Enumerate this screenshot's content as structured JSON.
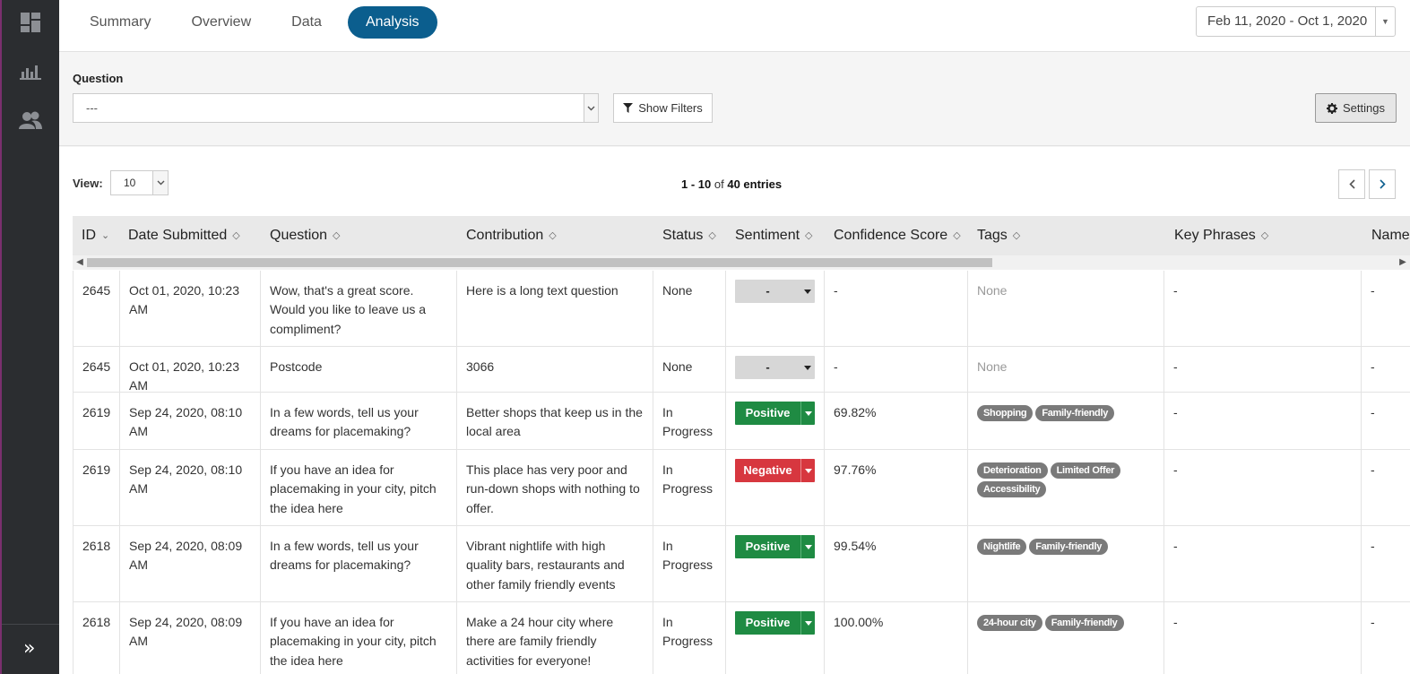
{
  "sidebar": {
    "icons": [
      "dashboard-icon",
      "bar-chart-icon",
      "users-icon"
    ],
    "expand_icon": "»"
  },
  "tabs": [
    {
      "label": "Summary",
      "active": false
    },
    {
      "label": "Overview",
      "active": false
    },
    {
      "label": "Data",
      "active": false
    },
    {
      "label": "Analysis",
      "active": true
    }
  ],
  "date_range": {
    "value": "Feb 11, 2020 - Oct 1, 2020"
  },
  "filter": {
    "question_label": "Question",
    "question_value": "---",
    "show_filters_label": "Show Filters",
    "settings_label": "Settings"
  },
  "view": {
    "label": "View:",
    "value": "10"
  },
  "entries": {
    "range": "1 - 10",
    "of": "of",
    "total": "40 entries"
  },
  "columns": [
    "ID",
    "Date Submitted",
    "Question",
    "Contribution",
    "Status",
    "Sentiment",
    "Confidence Score",
    "Tags",
    "Key Phrases",
    "Name"
  ],
  "rows": [
    {
      "id": "2645",
      "date": "Oct 01, 2020, 10:23 AM",
      "question": "Wow, that's a great score. Would you like to leave us a compliment?",
      "contribution": "Here is a long text question",
      "status": "None",
      "sentiment": "-",
      "sentiment_type": "none",
      "confidence": "-",
      "tags": [],
      "tags_empty": "None",
      "key_phrases": "-",
      "name": "-"
    },
    {
      "id": "2645",
      "date": "Oct 01, 2020, 10:23 AM",
      "question": "Postcode",
      "contribution": "3066",
      "status": "None",
      "sentiment": "-",
      "sentiment_type": "none",
      "confidence": "-",
      "tags": [],
      "tags_empty": "None",
      "key_phrases": "-",
      "name": "-"
    },
    {
      "id": "2619",
      "date": "Sep 24, 2020, 08:10 AM",
      "question": "In a few words, tell us your dreams for placemaking?",
      "contribution": "Better shops that keep us in the local area",
      "status": "In Progress",
      "sentiment": "Positive",
      "sentiment_type": "pos",
      "confidence": "69.82%",
      "tags": [
        "Shopping",
        "Family-friendly"
      ],
      "key_phrases": "-",
      "name": "-"
    },
    {
      "id": "2619",
      "date": "Sep 24, 2020, 08:10 AM",
      "question": "If you have an idea for placemaking in your city, pitch the idea here",
      "contribution": "This place has very poor and run-down shops with nothing to offer.",
      "status": "In Progress",
      "sentiment": "Negative",
      "sentiment_type": "neg",
      "confidence": "97.76%",
      "tags": [
        "Deterioration",
        "Limited Offer",
        "Accessibility"
      ],
      "key_phrases": "-",
      "name": "-"
    },
    {
      "id": "2618",
      "date": "Sep 24, 2020, 08:09 AM",
      "question": "In a few words, tell us your dreams for placemaking?",
      "contribution": "Vibrant nightlife with high quality bars, restaurants and other family friendly events",
      "status": "In Progress",
      "sentiment": "Positive",
      "sentiment_type": "pos",
      "confidence": "99.54%",
      "tags": [
        "Nightlife",
        "Family-friendly"
      ],
      "key_phrases": "-",
      "name": "-"
    },
    {
      "id": "2618",
      "date": "Sep 24, 2020, 08:09 AM",
      "question": "If you have an idea for placemaking in your city, pitch the idea here",
      "contribution": "Make a 24 hour city where there are family friendly activities for everyone!",
      "status": "In Progress",
      "sentiment": "Positive",
      "sentiment_type": "pos",
      "confidence": "100.00%",
      "tags": [
        "24-hour city",
        "Family-friendly"
      ],
      "key_phrases": "-",
      "name": "-"
    }
  ],
  "colors": {
    "accent": "#0b5e8e",
    "positive": "#1f8b43",
    "negative": "#d7373f",
    "sidebar": "#2b2d30"
  }
}
